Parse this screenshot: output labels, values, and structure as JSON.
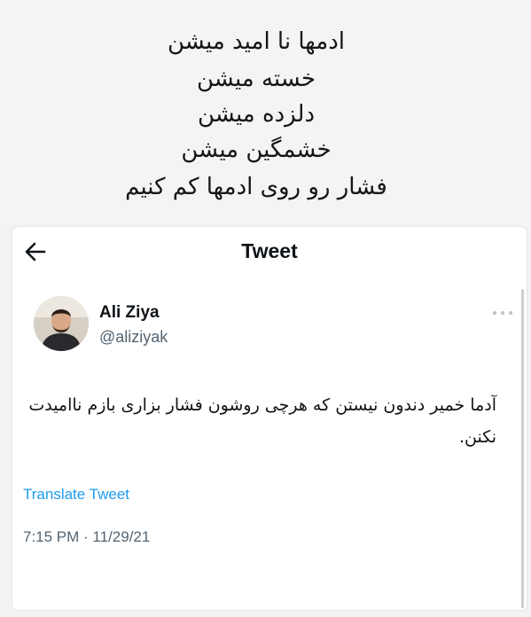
{
  "caption": {
    "lines": [
      "ادمها نا امید میشن",
      "خسته میشن",
      "دلزده میشن",
      "خشمگین میشن",
      "فشار رو روی ادمها کم کنیم"
    ]
  },
  "header": {
    "title": "Tweet",
    "back_icon": "arrow-left-icon"
  },
  "tweet": {
    "author_name": "Ali Ziya",
    "author_handle": "@aliziyak",
    "more_icon": "more-dots-icon",
    "text": "آدما خمیر دندون نیستن که هرچی روشون فشار بزاری بازم ناامیدت نکنن.",
    "translate_label": "Translate Tweet",
    "timestamp": "7:15 PM · 11/29/21"
  },
  "colors": {
    "link": "#1d9bf0",
    "secondary_text": "#536471",
    "primary_text": "#0f1419"
  }
}
